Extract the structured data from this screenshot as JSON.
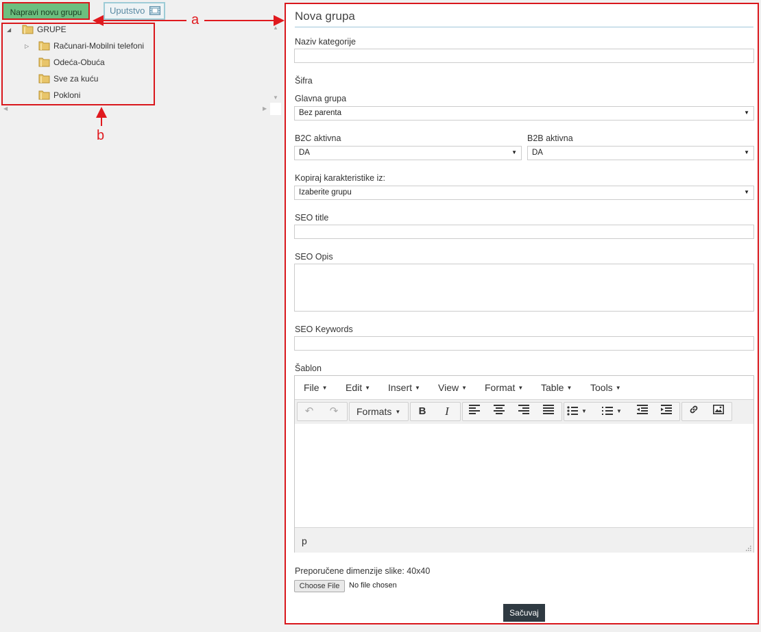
{
  "left": {
    "new_group_button": "Napravi novu grupu",
    "help_button": "Uputstvo",
    "tree": {
      "root": "GRUPE",
      "children": [
        "Računari-Mobilni telefoni",
        "Odeća-Obuća",
        "Sve za kuću",
        "Pokloni"
      ]
    }
  },
  "annotations": {
    "a": "a",
    "b": "b"
  },
  "form": {
    "title": "Nova grupa",
    "naziv_label": "Naziv kategorije",
    "naziv_value": "",
    "sifra_label": "Šifra",
    "glavna_label": "Glavna grupa",
    "glavna_value": "Bez parenta",
    "b2c_label": "B2C aktivna",
    "b2c_value": "DA",
    "b2b_label": "B2B aktivna",
    "b2b_value": "DA",
    "kopiraj_label": "Kopiraj karakteristike iz:",
    "kopiraj_value": "Izaberite grupu",
    "seo_title_label": "SEO title",
    "seo_title_value": "",
    "seo_opis_label": "SEO Opis",
    "seo_opis_value": "",
    "seo_keywords_label": "SEO Keywords",
    "seo_keywords_value": "",
    "sablon_label": "Šablon",
    "editor": {
      "menu": [
        "File",
        "Edit",
        "Insert",
        "View",
        "Format",
        "Table",
        "Tools"
      ],
      "formats_label": "Formats",
      "status_path": "p"
    },
    "image_hint": "Preporučene dimenzije slike: 40x40",
    "choose_file": "Choose File",
    "no_file": "No file chosen",
    "save_button": "Sačuvaj"
  },
  "colors": {
    "highlight_border": "#d9161b",
    "new_button_bg": "#6cbf7f",
    "save_button_bg": "#2f3a42",
    "title_underline": "#9fc6d9"
  }
}
